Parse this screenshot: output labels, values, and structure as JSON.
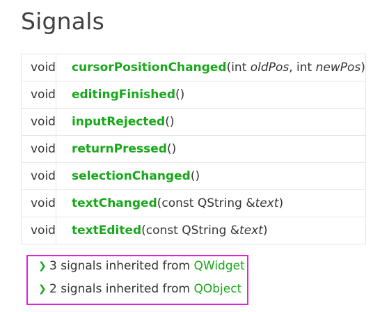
{
  "heading": "Signals",
  "signals": [
    {
      "return_type": "void",
      "name": "cursorPositionChanged",
      "params": [
        {
          "text": "(int "
        },
        {
          "text": "oldPos",
          "italic": true
        },
        {
          "text": ", int "
        },
        {
          "text": "newPos",
          "italic": true
        },
        {
          "text": ")"
        }
      ]
    },
    {
      "return_type": "void",
      "name": "editingFinished",
      "params": [
        {
          "text": "()"
        }
      ]
    },
    {
      "return_type": "void",
      "name": "inputRejected",
      "params": [
        {
          "text": "()"
        }
      ]
    },
    {
      "return_type": "void",
      "name": "returnPressed",
      "params": [
        {
          "text": "()"
        }
      ]
    },
    {
      "return_type": "void",
      "name": "selectionChanged",
      "params": [
        {
          "text": "()"
        }
      ]
    },
    {
      "return_type": "void",
      "name": "textChanged",
      "params": [
        {
          "text": "(const QString &"
        },
        {
          "text": "text",
          "italic": true
        },
        {
          "text": ")"
        }
      ]
    },
    {
      "return_type": "void",
      "name": "textEdited",
      "params": [
        {
          "text": "(const QString &"
        },
        {
          "text": "text",
          "italic": true
        },
        {
          "text": ")"
        }
      ]
    }
  ],
  "inherited": [
    {
      "text": "3 signals inherited from ",
      "link": "QWidget"
    },
    {
      "text": "2 signals inherited from ",
      "link": "QObject"
    }
  ],
  "icons": {
    "expand": "chevron-right-icon"
  },
  "colors": {
    "link": "#17a81a",
    "highlight_box": "#e021e0",
    "border": "#e6e6e6"
  }
}
